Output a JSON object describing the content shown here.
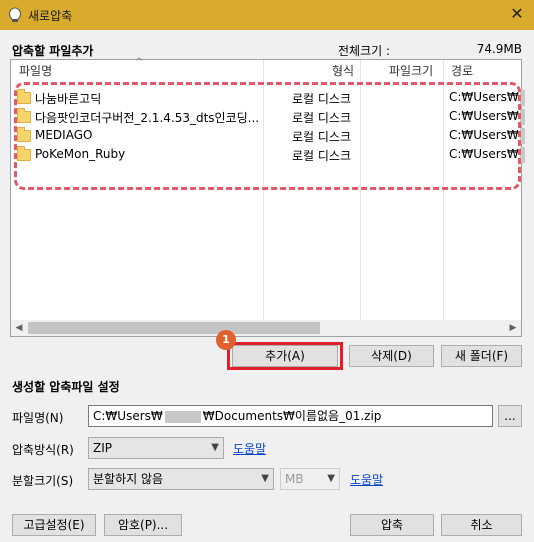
{
  "window": {
    "title": "새로압축",
    "close_glyph": "✕"
  },
  "files_section": {
    "label": "압축할 파일추가",
    "total_size_label": "전체크기 :",
    "total_size_value": "74.9MB",
    "columns": {
      "name": "파일명",
      "type": "형식",
      "size": "파일크기",
      "path": "경로"
    },
    "rows": [
      {
        "name": "나눔바른고딕",
        "type": "로컬 디스크",
        "size": "",
        "path": "C:₩Users₩"
      },
      {
        "name": "다음팟인코더구버전_2.1.4.53_dts인코딩...",
        "type": "로컬 디스크",
        "size": "",
        "path": "C:₩Users₩"
      },
      {
        "name": "MEDIAGO",
        "type": "로컬 디스크",
        "size": "",
        "path": "C:₩Users₩"
      },
      {
        "name": "PoKeMon_Ruby",
        "type": "로컬 디스크",
        "size": "",
        "path": "C:₩Users₩"
      }
    ]
  },
  "file_buttons": {
    "add": "추가(A)",
    "delete": "삭제(D)",
    "new_folder": "새 폴더(F)"
  },
  "annotation": {
    "badge": "1",
    "accent": "#e0212b"
  },
  "archive_section": {
    "label": "생성할 압축파일 설정",
    "filename_label": "파일명(N)",
    "filename_prefix": "C:₩Users₩",
    "filename_suffix": "₩Documents₩이름없음_01.zip",
    "browse_label": "...",
    "method_label": "압축방식(R)",
    "method_value": "ZIP",
    "split_label": "분할크기(S)",
    "split_value": "분할하지 않음",
    "unit_value": "MB",
    "help_link": "도움말"
  },
  "footer": {
    "advanced": "고급설정(E)",
    "password": "암호(P)...",
    "compress": "압축",
    "cancel": "취소"
  }
}
